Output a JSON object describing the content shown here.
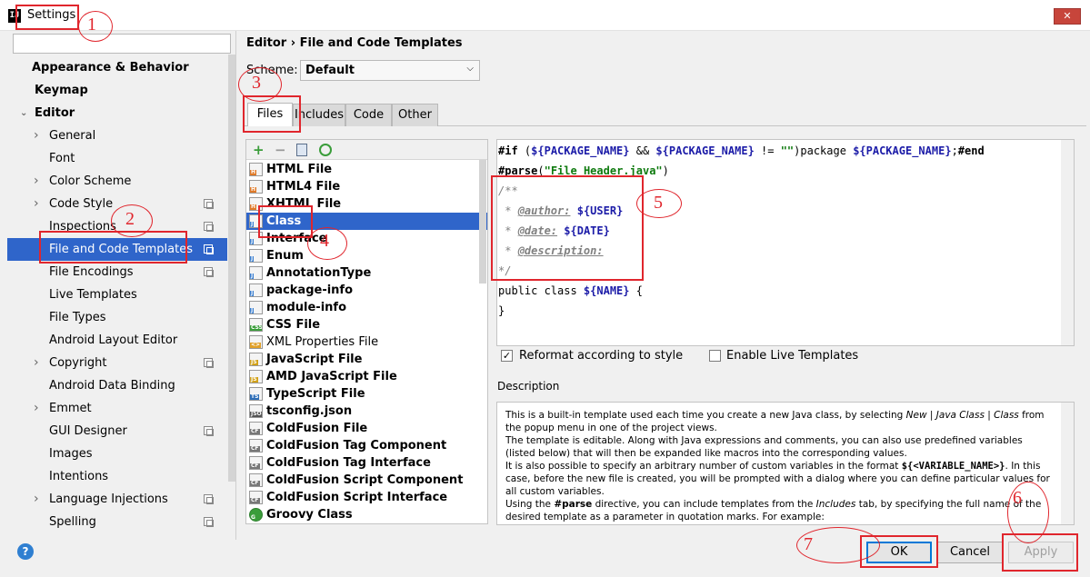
{
  "window": {
    "title": "Settings",
    "icon_text": "IJ",
    "close_icon": "close-icon"
  },
  "sidebar": {
    "search_placeholder": "",
    "items": [
      {
        "label": "Appearance & Behavior",
        "bold": true,
        "arrow": false
      },
      {
        "label": "Keymap",
        "bold": true,
        "arrow": false
      },
      {
        "label": "Editor",
        "bold": true,
        "arrow": "down"
      },
      {
        "label": "General",
        "arrow": "right"
      },
      {
        "label": "Font"
      },
      {
        "label": "Color Scheme",
        "arrow": "right"
      },
      {
        "label": "Code Style",
        "arrow": "right",
        "copy": true
      },
      {
        "label": "Inspections",
        "copy": true
      },
      {
        "label": "File and Code Templates",
        "copy": true,
        "selected": true
      },
      {
        "label": "File Encodings",
        "copy": true
      },
      {
        "label": "Live Templates"
      },
      {
        "label": "File Types"
      },
      {
        "label": "Android Layout Editor"
      },
      {
        "label": "Copyright",
        "arrow": "right",
        "copy": true
      },
      {
        "label": "Android Data Binding"
      },
      {
        "label": "Emmet",
        "arrow": "right"
      },
      {
        "label": "GUI Designer",
        "copy": true
      },
      {
        "label": "Images"
      },
      {
        "label": "Intentions"
      },
      {
        "label": "Language Injections",
        "arrow": "right",
        "copy": true
      },
      {
        "label": "Spelling",
        "copy": true
      }
    ]
  },
  "main": {
    "breadcrumb": "Editor › File and Code Templates",
    "scheme_label": "Scheme:",
    "scheme_value": "Default",
    "tabs": [
      "Files",
      "Includes",
      "Code",
      "Other"
    ],
    "active_tab": "Files",
    "toolbar": {
      "add": "+",
      "remove": "−",
      "copy": "copy-icon",
      "reset": "reset-icon"
    },
    "templates": [
      {
        "label": "HTML File",
        "icon": "H"
      },
      {
        "label": "HTML4 File",
        "icon": "H"
      },
      {
        "label": "XHTML File",
        "icon": "H"
      },
      {
        "label": "Class",
        "icon": "J",
        "selected": true
      },
      {
        "label": "Interface",
        "icon": "J"
      },
      {
        "label": "Enum",
        "icon": "J"
      },
      {
        "label": "AnnotationType",
        "icon": "J"
      },
      {
        "label": "package-info",
        "icon": "J"
      },
      {
        "label": "module-info",
        "icon": "J"
      },
      {
        "label": "CSS File",
        "icon": "CSS"
      },
      {
        "label": "XML Properties File",
        "icon": "<>",
        "normal": true
      },
      {
        "label": "JavaScript File",
        "icon": "JS"
      },
      {
        "label": "AMD JavaScript File",
        "icon": "JS"
      },
      {
        "label": "TypeScript File",
        "icon": "TS"
      },
      {
        "label": "tsconfig.json",
        "icon": "JSON"
      },
      {
        "label": "ColdFusion File",
        "icon": "CF"
      },
      {
        "label": "ColdFusion Tag Component",
        "icon": "CF"
      },
      {
        "label": "ColdFusion Tag Interface",
        "icon": "CF"
      },
      {
        "label": "ColdFusion Script Component",
        "icon": "CF"
      },
      {
        "label": "ColdFusion Script Interface",
        "icon": "CF"
      },
      {
        "label": "Groovy Class",
        "icon": "G"
      }
    ],
    "code": {
      "l1": {
        "a": "#if",
        "b": " (",
        "c": "${PACKAGE_NAME}",
        "d": " && ",
        "e": "${PACKAGE_NAME}",
        "f": " != ",
        "g": "\"\"",
        "h": ")package ",
        "i": "${PACKAGE_NAME}",
        "j": ";",
        "k": "#end"
      },
      "l2": {
        "a": "#parse",
        "b": "(",
        "c": "\"File Header.java\"",
        "d": ")"
      },
      "l3": "/**",
      "l4": {
        "a": " * ",
        "b": "@author:",
        "c": " ",
        "d": "${USER}"
      },
      "l5": {
        "a": " * ",
        "b": "@date:",
        "c": " ",
        "d": "${DATE}"
      },
      "l6": {
        "a": " * ",
        "b": "@description:"
      },
      "l7": "*/",
      "l8": {
        "a": "public class ",
        "b": "${NAME}",
        "c": " {"
      },
      "l9": "}"
    },
    "reformat_label": "Reformat according to style",
    "reformat_checked": true,
    "live_templates_label": "Enable Live Templates",
    "live_templates_checked": false,
    "description_label": "Description",
    "description": {
      "p1a": "This is a built-in template used each time you create a new Java class, by selecting ",
      "p1b": "New | Java Class | Class",
      "p1c": " from the popup menu in one of the project views.",
      "p2": "The template is editable. Along with Java expressions and comments, you can also use predefined variables (listed below) that will then be expanded like macros into the corresponding values.",
      "p3a": "It is also possible to specify an arbitrary number of custom variables in the format ",
      "p3b": "${<VARIABLE_NAME>}",
      "p3c": ". In this case, before the new file is created, you will be prompted with a dialog where you can define particular values for all custom variables.",
      "p4a": "Using the ",
      "p4b": "#parse",
      "p4c": " directive, you can include templates from the ",
      "p4d": "Includes",
      "p4e": " tab, by specifying the full name of the desired template as a parameter in quotation marks. For example:"
    }
  },
  "buttons": {
    "help": "?",
    "ok": "OK",
    "cancel": "Cancel",
    "apply": "Apply"
  },
  "annotations": [
    "1",
    "2",
    "3",
    "4",
    "5",
    "6",
    "7"
  ],
  "colors": {
    "selection": "#2f65ca",
    "annotation": "#e0262d",
    "variable": "#1c1ca8",
    "string": "#0e7a0e"
  }
}
